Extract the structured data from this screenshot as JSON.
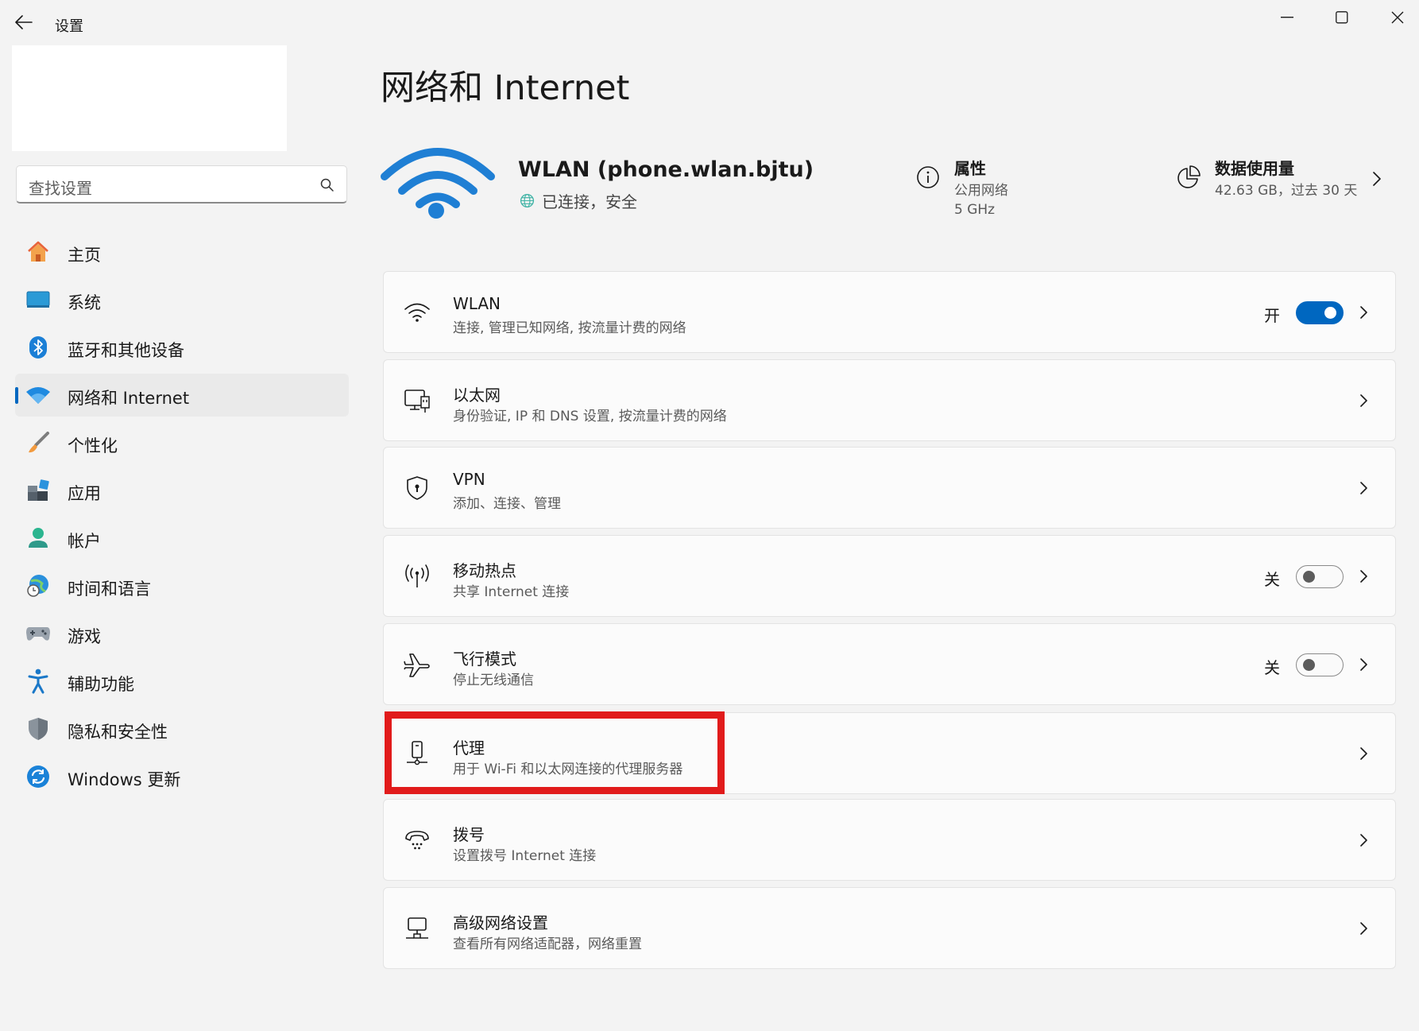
{
  "window": {
    "title": "设置"
  },
  "search": {
    "placeholder": "查找设置"
  },
  "sidebar": {
    "items": [
      {
        "label": "主页",
        "icon": "home-icon",
        "active": false
      },
      {
        "label": "系统",
        "icon": "system-icon",
        "active": false
      },
      {
        "label": "蓝牙和其他设备",
        "icon": "bluetooth-icon",
        "active": false
      },
      {
        "label": "网络和 Internet",
        "icon": "network-icon",
        "active": true
      },
      {
        "label": "个性化",
        "icon": "brush-icon",
        "active": false
      },
      {
        "label": "应用",
        "icon": "apps-icon",
        "active": false
      },
      {
        "label": "帐户",
        "icon": "account-icon",
        "active": false
      },
      {
        "label": "时间和语言",
        "icon": "time-language-icon",
        "active": false
      },
      {
        "label": "游戏",
        "icon": "gamepad-icon",
        "active": false
      },
      {
        "label": "辅助功能",
        "icon": "accessibility-icon",
        "active": false
      },
      {
        "label": "隐私和安全性",
        "icon": "shield-icon",
        "active": false
      },
      {
        "label": "Windows 更新",
        "icon": "windows-update-icon",
        "active": false
      }
    ]
  },
  "main": {
    "title": "网络和 Internet",
    "connection": {
      "ssid": "WLAN (phone.wlan.bjtu)",
      "status": "已连接，安全",
      "properties": {
        "title": "属性",
        "lines": [
          "公用网络",
          "5 GHz"
        ]
      },
      "data_usage": {
        "title": "数据使用量",
        "value": "42.63 GB，过去 30 天"
      }
    },
    "cards": [
      {
        "title": "WLAN",
        "subtitle": "连接, 管理已知网络, 按流量计费的网络",
        "icon": "wifi-icon",
        "toggle": "开",
        "toggle_on": true
      },
      {
        "title": "以太网",
        "subtitle": "身份验证, IP 和 DNS 设置, 按流量计费的网络",
        "icon": "ethernet-icon"
      },
      {
        "title": "VPN",
        "subtitle": "添加、连接、管理",
        "icon": "vpn-shield-icon"
      },
      {
        "title": "移动热点",
        "subtitle": "共享 Internet 连接",
        "icon": "hotspot-icon",
        "toggle": "关",
        "toggle_on": false
      },
      {
        "title": "飞行模式",
        "subtitle": "停止无线通信",
        "icon": "airplane-icon",
        "toggle": "关",
        "toggle_on": false
      },
      {
        "title": "代理",
        "subtitle": "用于 Wi-Fi 和以太网连接的代理服务器",
        "icon": "proxy-icon",
        "highlighted": true
      },
      {
        "title": "拨号",
        "subtitle": "设置拨号 Internet 连接",
        "icon": "dialup-icon"
      },
      {
        "title": "高级网络设置",
        "subtitle": "查看所有网络适配器，网络重置",
        "icon": "advanced-network-icon"
      }
    ]
  },
  "colors": {
    "accent": "#0067c0",
    "highlight": "#e11b1b",
    "background": "#f3f3f3",
    "card": "#fbfbfb"
  }
}
